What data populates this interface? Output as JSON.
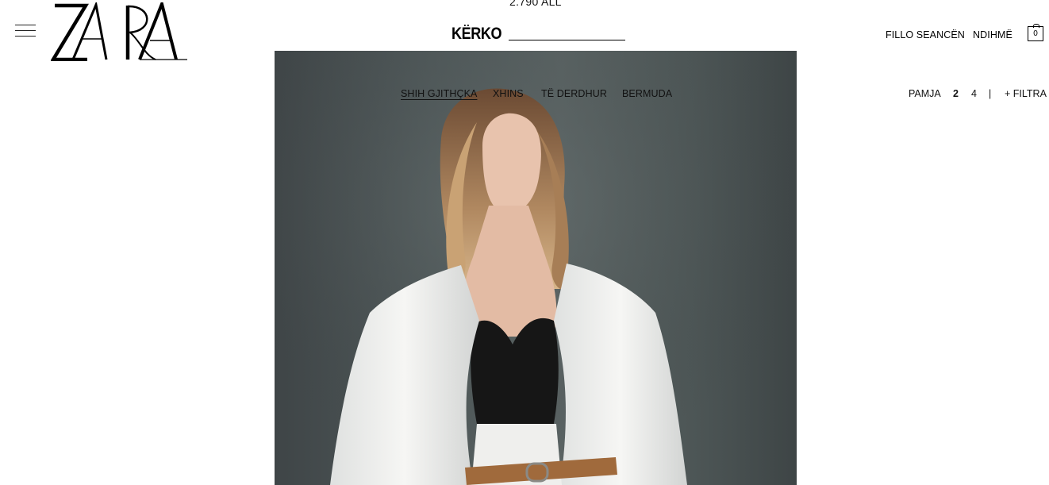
{
  "header": {
    "top_price": "2.790 ALL",
    "logo_text": "ZARA",
    "search_label": "KËRKO",
    "login_label": "FILLO SEANCËN",
    "help_label": "NDIHMË",
    "cart_count": "0"
  },
  "categories": [
    {
      "label": "SHIH GJITHÇKA",
      "active": true
    },
    {
      "label": "XHINS",
      "active": false
    },
    {
      "label": "TË DERDHUR",
      "active": false
    },
    {
      "label": "BERMUDA",
      "active": false
    }
  ],
  "view_controls": {
    "view_label": "PAMJA",
    "option_2": "2",
    "option_4": "4",
    "separator": "|",
    "filters_label": "+ FILTRA"
  },
  "hero": {
    "icon": "model-photo"
  }
}
